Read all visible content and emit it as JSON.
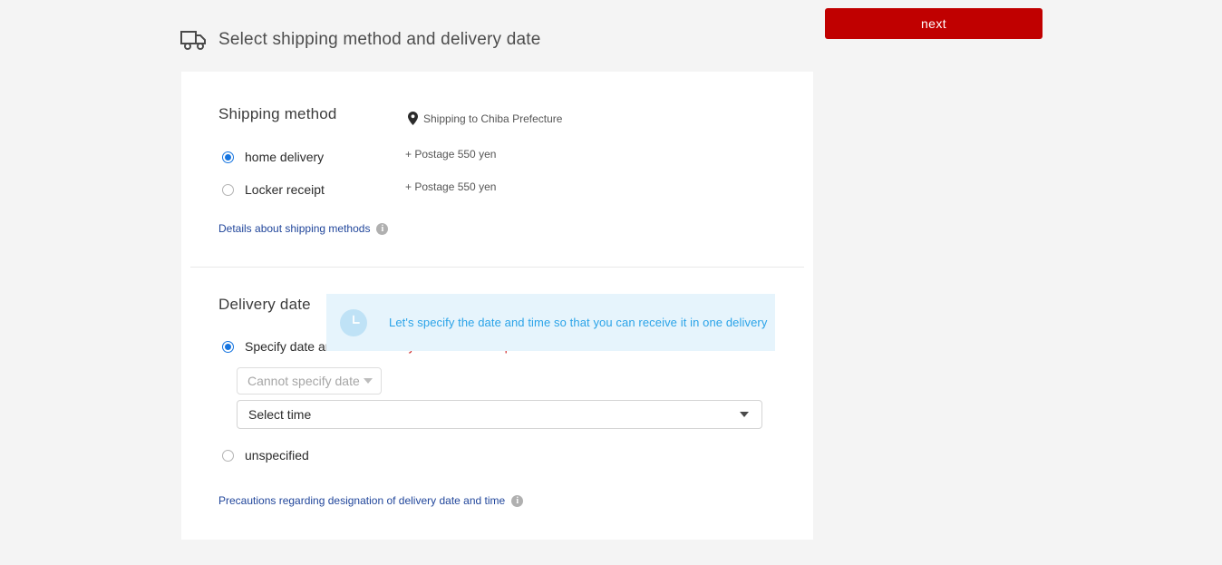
{
  "header": {
    "icon": "truck-icon",
    "title": "Select shipping method and delivery date"
  },
  "next_button": {
    "label": "next",
    "color": "#c00000"
  },
  "shipping_section": {
    "title": "Shipping method",
    "ship_to": {
      "icon": "map-pin-icon",
      "text": "Shipping to Chiba Prefecture"
    },
    "options": [
      {
        "label": "home delivery",
        "postage": "+ Postage 550 yen",
        "selected": true
      },
      {
        "label": "Locker receipt",
        "postage": "+ Postage 550 yen",
        "selected": false
      }
    ],
    "details_link": {
      "text": "Details about shipping methods",
      "icon": "info-icon"
    }
  },
  "delivery_section": {
    "title": "Delivery date",
    "options": [
      {
        "label": "Specify date and time",
        "selected": true
      },
      {
        "label": "unspecified",
        "selected": false
      }
    ],
    "date_note": "Delivery date cannot be specified",
    "date_select": {
      "value": "Cannot specify date",
      "disabled": true
    },
    "time_select": {
      "value": "Select time",
      "disabled": false
    },
    "precautions_link": {
      "text": "Precautions regarding designation of delivery date and time",
      "icon": "info-icon"
    }
  },
  "tip_banner": {
    "icon": "clock-icon",
    "text": "Let's specify the date and time so that you can receive it in one delivery",
    "background": "#e6f4fc",
    "text_color": "#2aa3e8"
  }
}
